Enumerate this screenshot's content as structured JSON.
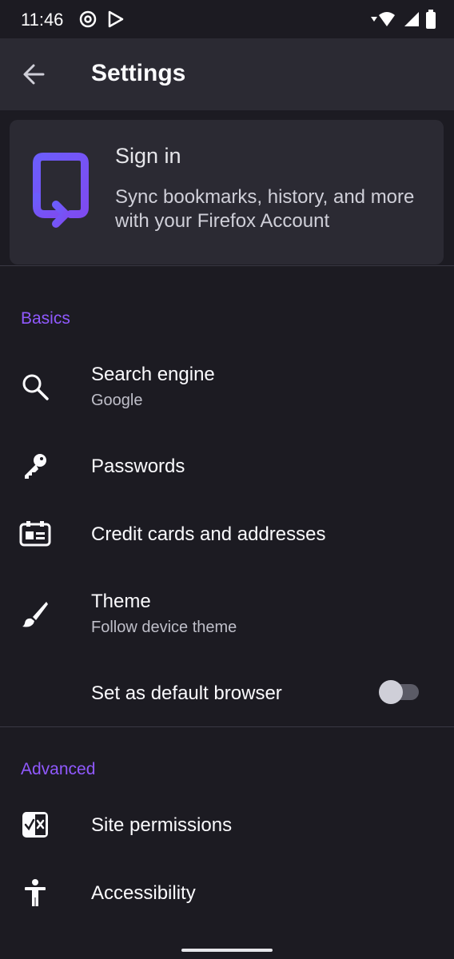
{
  "status_bar": {
    "time": "11:46"
  },
  "app_bar": {
    "title": "Settings"
  },
  "sign_in": {
    "title": "Sign in",
    "description": "Sync bookmarks, history, and more with your Firefox Account"
  },
  "sections": {
    "basics": {
      "header": "Basics",
      "search_engine": {
        "title": "Search engine",
        "subtitle": "Google"
      },
      "passwords": {
        "title": "Passwords"
      },
      "credit_cards": {
        "title": "Credit cards and addresses"
      },
      "theme": {
        "title": "Theme",
        "subtitle": "Follow device theme"
      },
      "default_browser": {
        "title": "Set as default browser",
        "enabled": false
      }
    },
    "advanced": {
      "header": "Advanced",
      "site_permissions": {
        "title": "Site permissions"
      },
      "accessibility": {
        "title": "Accessibility"
      }
    }
  },
  "colors": {
    "background": "#1c1b22",
    "surface": "#2b2a33",
    "accent": "#9059ff",
    "text_primary": "#fbfbfe",
    "text_secondary": "#bfbfc9"
  }
}
